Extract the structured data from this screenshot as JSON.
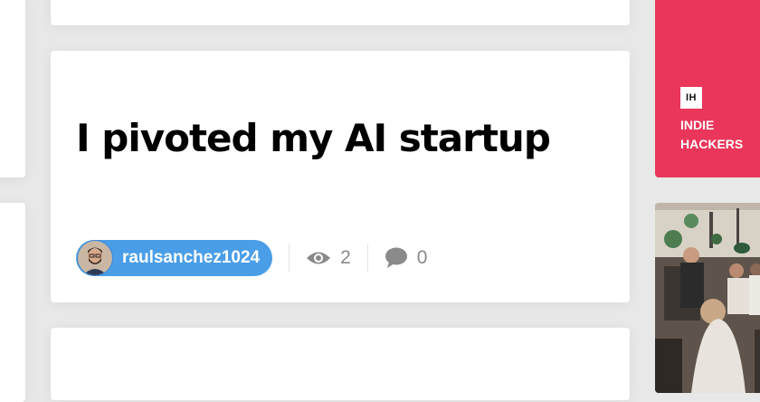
{
  "post": {
    "title": "I pivoted my AI startup",
    "author": "raulsanchez1024",
    "views": "2",
    "comments": "0"
  },
  "sidebar_ad": {
    "logo": "IH",
    "line1": "INDIE",
    "line2": "HACKERS"
  },
  "icons": {
    "views": "eye-icon",
    "comments": "speech-bubble-icon"
  },
  "colors": {
    "author_pill": "#4a9ee8",
    "ad_background": "#e9365a",
    "background": "#e8e8e8"
  }
}
